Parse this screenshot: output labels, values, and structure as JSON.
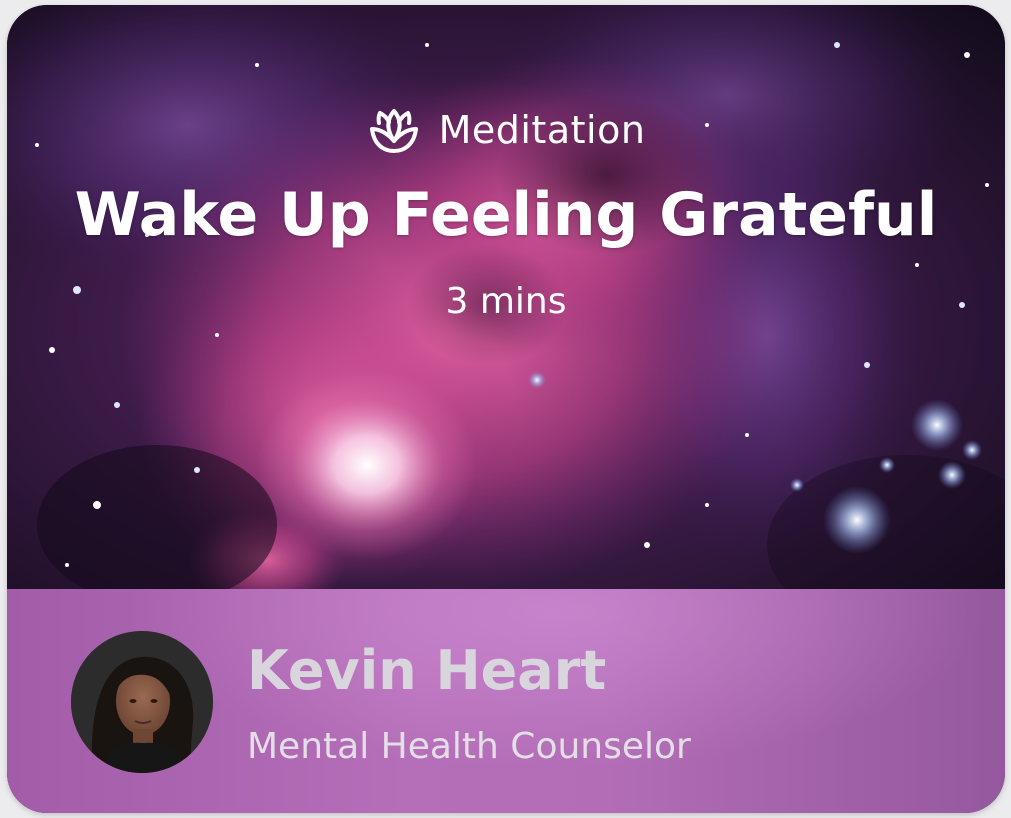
{
  "session": {
    "category": "Meditation",
    "category_icon": "lotus-icon",
    "title": "Wake Up Feeling Grateful",
    "duration": "3 mins"
  },
  "coach": {
    "name": "Kevin Heart",
    "role": "Mental Health Counselor"
  },
  "colors": {
    "footer_start": "#a35ca8",
    "footer_end": "#95589e",
    "nebula_pink": "#d2508f",
    "nebula_purple": "#6b3a8f",
    "space_dark": "#1a0f24"
  }
}
